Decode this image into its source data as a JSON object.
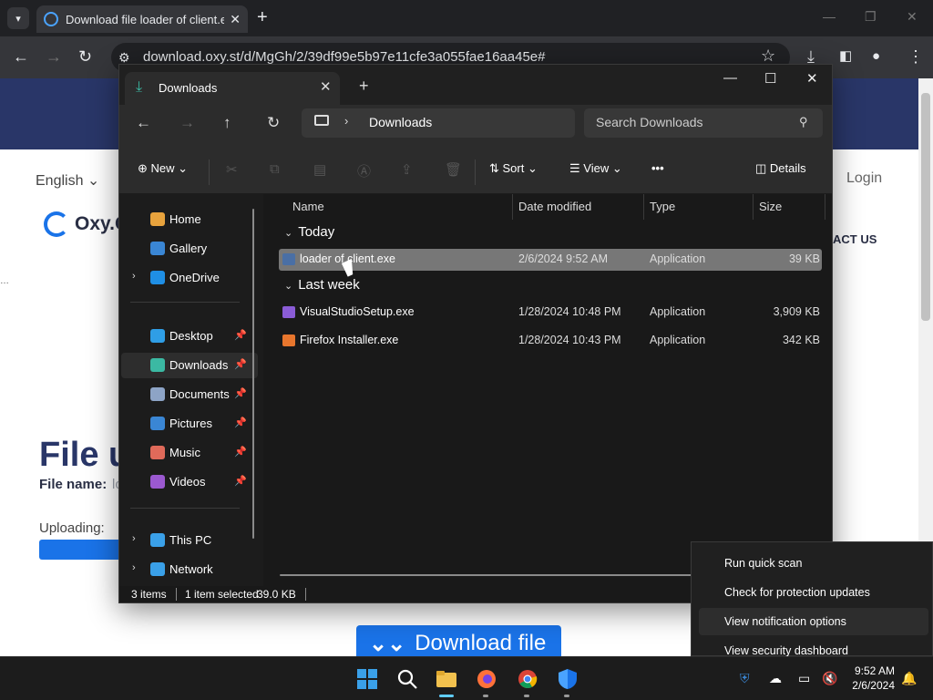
{
  "browser": {
    "tab_title": "Download file loader of client.exe",
    "url": "download.oxy.st/d/MgGh/2/39df99e5b97e11cfe3a055fae16aa45e#"
  },
  "website": {
    "language": "English",
    "login": "Login",
    "logo_text": "Oxy.Cloud",
    "contact": "ACT US",
    "heading": "File u",
    "file_name_label": "File name:",
    "file_name_value": "lo",
    "uploading_label": "Uploading:",
    "download_button": "Download file"
  },
  "explorer": {
    "tab_title": "Downloads",
    "breadcrumb": "Downloads",
    "search_placeholder": "Search Downloads",
    "toolbar": {
      "new_label": "New",
      "sort_label": "Sort",
      "view_label": "View",
      "details_label": "Details"
    },
    "nav_pane": [
      {
        "label": "Home",
        "icon": "home-icon",
        "color": "#e8a33d"
      },
      {
        "label": "Gallery",
        "icon": "gallery-icon",
        "color": "#3a86d4"
      },
      {
        "label": "OneDrive",
        "icon": "cloud-icon",
        "color": "#1f8fe5",
        "expandable": true
      },
      {
        "label": "Desktop",
        "icon": "desktop-icon",
        "color": "#2f9ee6",
        "pinned": true
      },
      {
        "label": "Downloads",
        "icon": "download-icon",
        "color": "#3bb9a3",
        "pinned": true,
        "selected": true
      },
      {
        "label": "Documents",
        "icon": "documents-icon",
        "color": "#8da4c6",
        "pinned": true
      },
      {
        "label": "Pictures",
        "icon": "pictures-icon",
        "color": "#3a86d4",
        "pinned": true
      },
      {
        "label": "Music",
        "icon": "music-icon",
        "color": "#e06a5a",
        "pinned": true
      },
      {
        "label": "Videos",
        "icon": "videos-icon",
        "color": "#9b59d0",
        "pinned": true
      },
      {
        "label": "This PC",
        "icon": "pc-icon",
        "color": "#3aa0e8",
        "expandable": true
      },
      {
        "label": "Network",
        "icon": "network-icon",
        "color": "#3aa0e8",
        "expandable": true
      }
    ],
    "columns": {
      "name": "Name",
      "date": "Date modified",
      "type": "Type",
      "size": "Size"
    },
    "groups": [
      {
        "label": "Today",
        "files": [
          {
            "name": "loader of client.exe",
            "date": "2/6/2024 9:52 AM",
            "type": "Application",
            "size": "39 KB",
            "selected": true,
            "icon_color": "#4a6fa5"
          }
        ]
      },
      {
        "label": "Last week",
        "files": [
          {
            "name": "VisualStudioSetup.exe",
            "date": "1/28/2024 10:48 PM",
            "type": "Application",
            "size": "3,909 KB",
            "selected": false,
            "icon_color": "#8a5cd6"
          },
          {
            "name": "Firefox Installer.exe",
            "date": "1/28/2024 10:43 PM",
            "type": "Application",
            "size": "342 KB",
            "selected": false,
            "icon_color": "#e8762d"
          }
        ]
      }
    ],
    "status": {
      "items": "3 items",
      "selected": "1 item selected",
      "size": "39.0 KB"
    }
  },
  "context_menu": {
    "items": [
      {
        "label": "Run quick scan"
      },
      {
        "label": "Check for protection updates"
      },
      {
        "label": "View notification options",
        "hover": true
      },
      {
        "label": "View security dashboard"
      }
    ]
  },
  "taskbar": {
    "time": "9:52 AM",
    "date": "2/6/2024"
  }
}
